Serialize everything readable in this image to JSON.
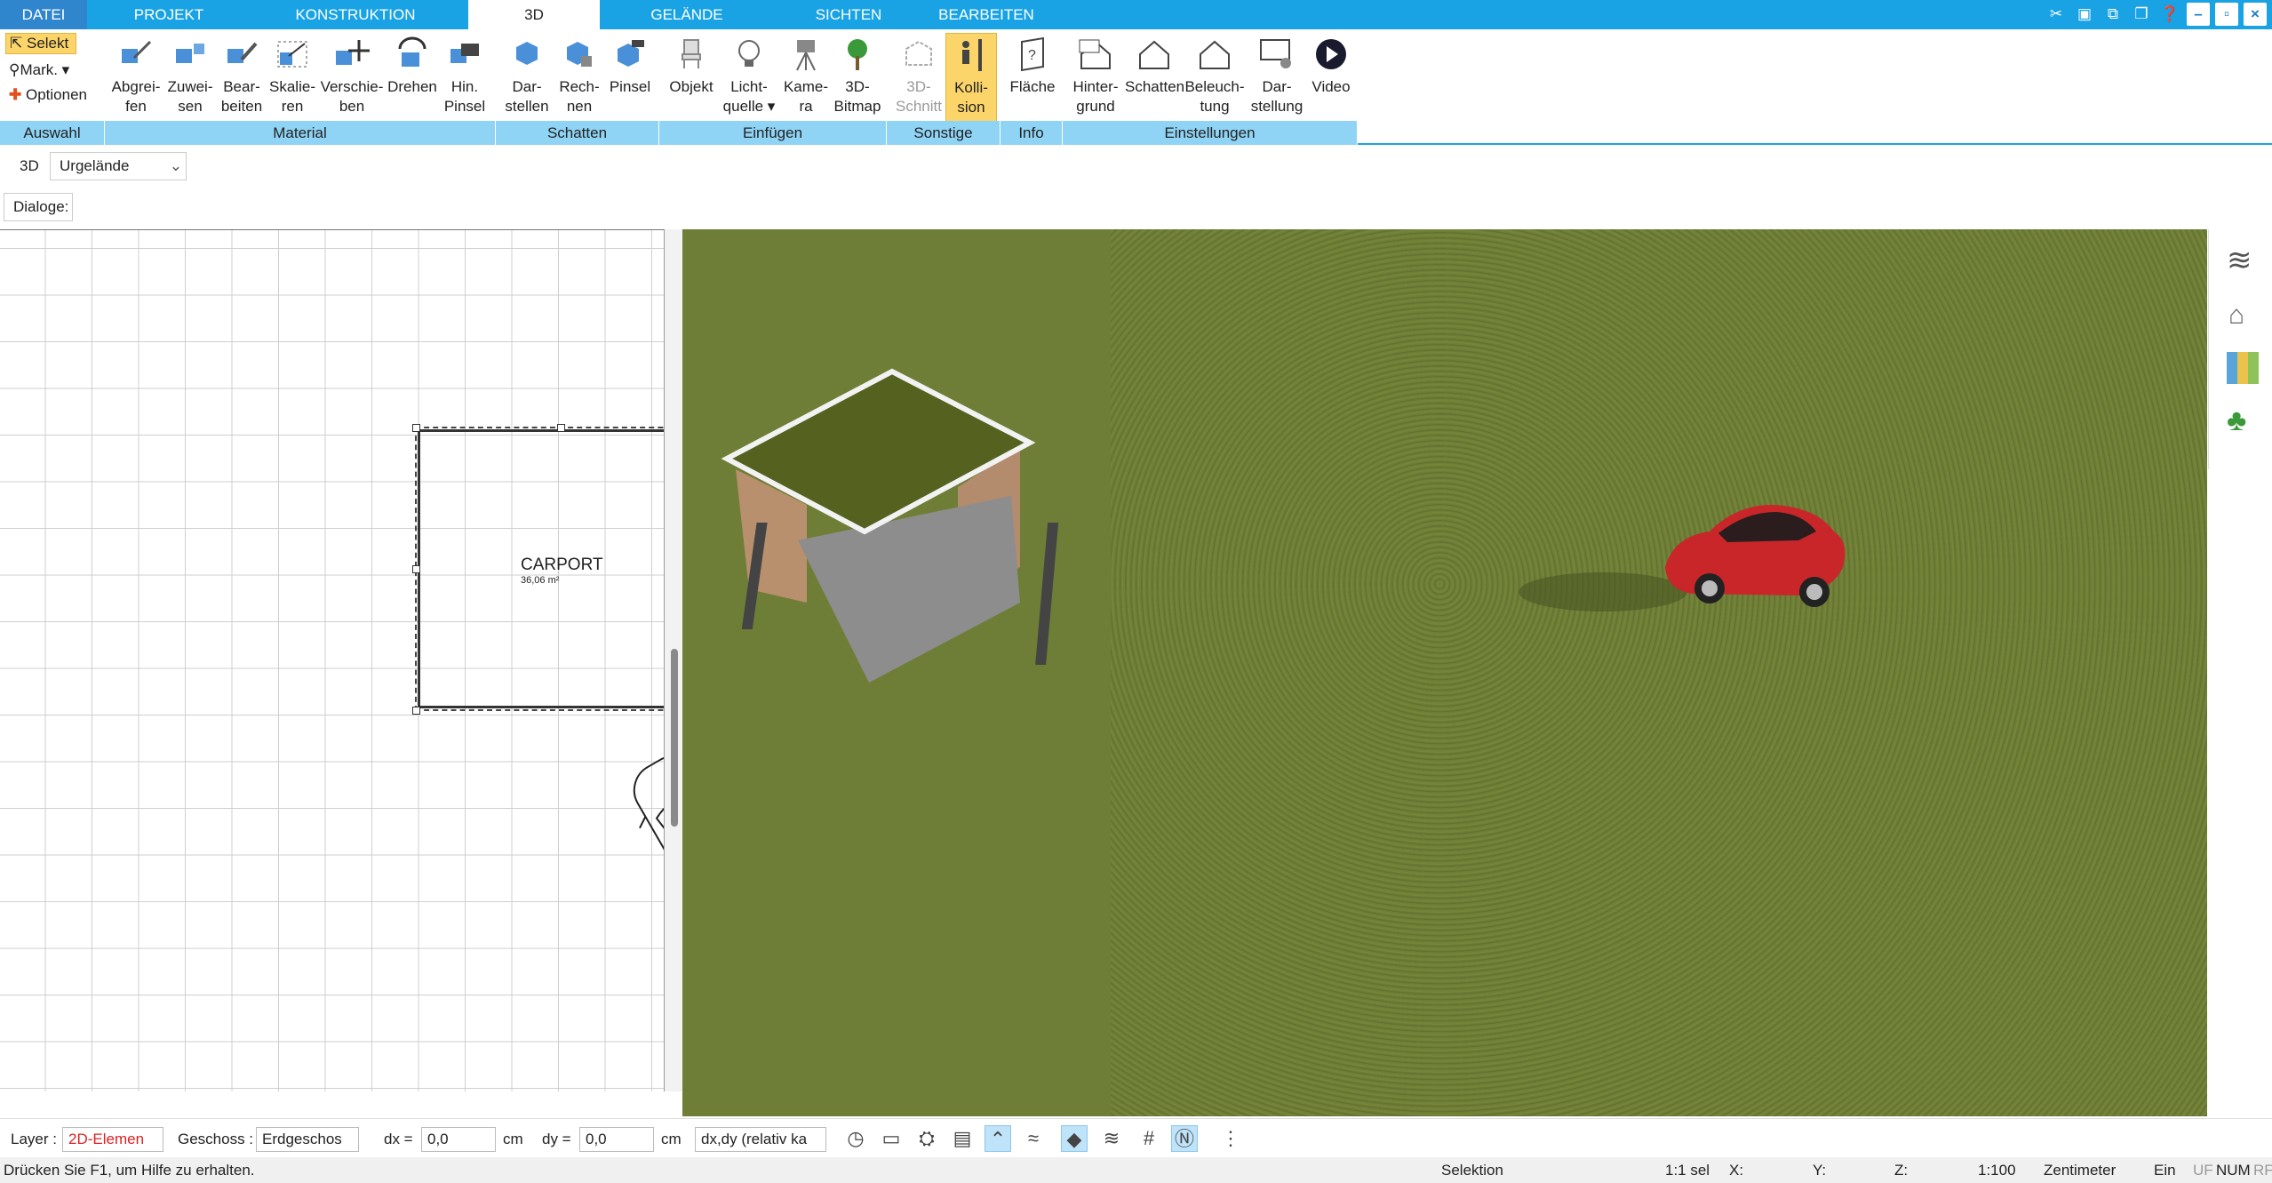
{
  "tabs": {
    "datei": "DATEI",
    "projekt": "PROJEKT",
    "konstruktion": "KONSTRUKTION",
    "d3": "3D",
    "gelaende": "GELÄNDE",
    "sichten": "SICHTEN",
    "bearbeiten": "BEARBEITEN"
  },
  "auswahl": {
    "selekt": "Selekt",
    "mark": "Mark.",
    "optionen": "Optionen"
  },
  "material": {
    "abgreifen1": "Abgrei-",
    "abgreifen2": "fen",
    "zuweisen1": "Zuwei-",
    "zuweisen2": "sen",
    "bearbeiten1": "Bear-",
    "bearbeiten2": "beiten",
    "skalieren1": "Skalie-",
    "skalieren2": "ren",
    "verschieben1": "Verschie-",
    "verschieben2": "ben",
    "drehen": "Drehen",
    "hin1": "Hin.",
    "hin2": "Pinsel"
  },
  "schatten": {
    "darstellen1": "Dar-",
    "darstellen2": "stellen",
    "rechnen1": "Rech-",
    "rechnen2": "nen",
    "pinsel": "Pinsel"
  },
  "einfuegen": {
    "objekt": "Objekt",
    "licht1": "Licht-",
    "licht2": "quelle",
    "kamera1": "Kame-",
    "kamera2": "ra",
    "bitmap1": "3D-",
    "bitmap2": "Bitmap"
  },
  "sonstige": {
    "schnitt1": "3D-",
    "schnitt2": "Schnitt",
    "kollision1": "Kolli-",
    "kollision2": "sion"
  },
  "info": {
    "flaeche": "Fläche"
  },
  "einstellungen": {
    "hinter1": "Hinter-",
    "hinter2": "grund",
    "schatten": "Schatten",
    "beleucht1": "Beleuch-",
    "beleucht2": "tung",
    "darst1": "Dar-",
    "darst2": "stellung",
    "video": "Video"
  },
  "groups": {
    "auswahl": "Auswahl",
    "material": "Material",
    "schatten": "Schatten",
    "einfuegen": "Einfügen",
    "sonstige": "Sonstige",
    "info": "Info",
    "einstellungen": "Einstellungen"
  },
  "viewbar": {
    "mode": "3D",
    "terrain": "Urgelände",
    "dialoge": "Dialoge:"
  },
  "plan": {
    "room_name": "CARPORT",
    "room_area": "36,06 m²"
  },
  "bottom": {
    "layer_label": "Layer :",
    "layer_value": "2D-Elemen",
    "geschoss_label": "Geschoss :",
    "geschoss_value": "Erdgeschos",
    "dx_label": "dx =",
    "dx_value": "0,0",
    "dx_unit": "cm",
    "dy_label": "dy =",
    "dy_value": "0,0",
    "dy_unit": "cm",
    "mode_value": "dx,dy (relativ ka"
  },
  "status": {
    "help": "Drücken Sie F1, um Hilfe zu erhalten.",
    "mode": "Selektion",
    "sel": "1:1 sel",
    "x": "X:",
    "y": "Y:",
    "z": "Z:",
    "scale": "1:100",
    "unit": "Zentimeter",
    "ein": "Ein",
    "uf": "UF",
    "num": "NUM",
    "rf": "RF"
  },
  "colors": {
    "accent": "#1aa3e4",
    "ribbon_group": "#8fd3f5",
    "active_button": "#fcd56a",
    "car": "#c9262a",
    "grass": "#6e7e36"
  }
}
